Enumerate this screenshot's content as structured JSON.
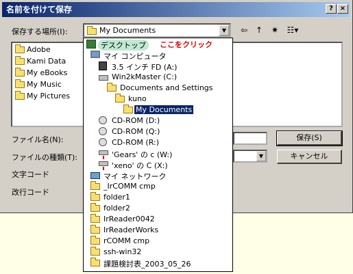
{
  "window": {
    "title": "名前を付けて保存"
  },
  "titlebar_buttons": {
    "help": "?",
    "close": "×"
  },
  "save_in": {
    "label": "保存する場所(I):",
    "value": "My Documents"
  },
  "toolbar": {
    "back": "⇦",
    "up": "↑",
    "new_folder": "✷",
    "view": "☷▾"
  },
  "file_list": [
    "Adobe",
    "Kami Data",
    "My eBooks",
    "My Music",
    "My Pictures"
  ],
  "fields": {
    "filename_label": "ファイル名(N):",
    "filetype_label": "ファイルの種類(T):",
    "encoding_label": "文字コード",
    "newline_label": "改行コード"
  },
  "buttons": {
    "save": "保存(S)",
    "cancel": "キャンセル"
  },
  "annotation": "ここをクリック",
  "dropdown": [
    {
      "label": "デスクトップ",
      "icon": "desktop-icon"
    },
    {
      "label": "マイ コンピュータ",
      "icon": "computer-icon"
    },
    {
      "label": "3.5 インチ FD (A:)",
      "icon": "floppy-icon"
    },
    {
      "label": "Win2kMaster (C:)",
      "icon": "drive-icon"
    },
    {
      "label": "Documents and Settings",
      "icon": "folder-icon"
    },
    {
      "label": "kuno",
      "icon": "folder-icon"
    },
    {
      "label": "My Documents",
      "icon": "folder-open-icon"
    },
    {
      "label": "CD-ROM (D:)",
      "icon": "cd-icon"
    },
    {
      "label": "CD-ROM (Q:)",
      "icon": "cd-icon"
    },
    {
      "label": "CD-ROM (R:)",
      "icon": "cd-icon"
    },
    {
      "label": "'Gears' の c (W:)",
      "icon": "network-drive-icon"
    },
    {
      "label": "'xeno' の C (X:)",
      "icon": "network-drive-icon"
    },
    {
      "label": "マイ ネットワーク",
      "icon": "network-icon"
    },
    {
      "label": "_IrCOMM cmp",
      "icon": "folder-icon"
    },
    {
      "label": "folder1",
      "icon": "folder-icon"
    },
    {
      "label": "folder2",
      "icon": "folder-icon"
    },
    {
      "label": "IrReader0042",
      "icon": "folder-icon"
    },
    {
      "label": "IrReaderWorks",
      "icon": "folder-icon"
    },
    {
      "label": "rCOMM cmp",
      "icon": "folder-icon"
    },
    {
      "label": "ssh-win32",
      "icon": "folder-icon"
    },
    {
      "label": "課題検討表_2003_05_26",
      "icon": "folder-icon"
    }
  ]
}
